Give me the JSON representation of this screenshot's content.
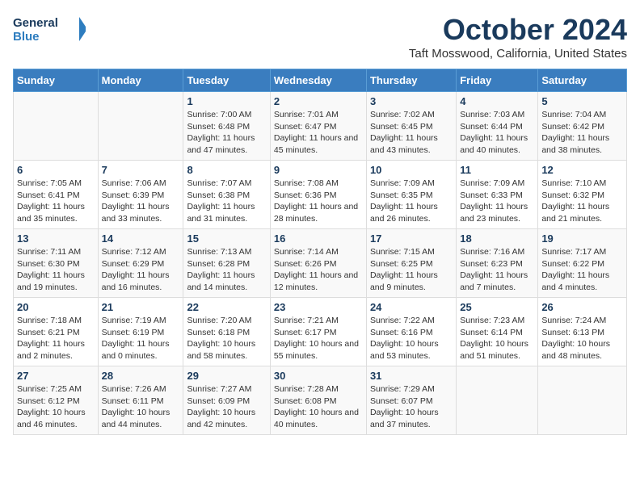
{
  "header": {
    "logo_line1": "General",
    "logo_line2": "Blue",
    "month": "October 2024",
    "location": "Taft Mosswood, California, United States"
  },
  "weekdays": [
    "Sunday",
    "Monday",
    "Tuesday",
    "Wednesday",
    "Thursday",
    "Friday",
    "Saturday"
  ],
  "weeks": [
    [
      null,
      null,
      {
        "day": "1",
        "sunrise": "Sunrise: 7:00 AM",
        "sunset": "Sunset: 6:48 PM",
        "daylight": "Daylight: 11 hours and 47 minutes."
      },
      {
        "day": "2",
        "sunrise": "Sunrise: 7:01 AM",
        "sunset": "Sunset: 6:47 PM",
        "daylight": "Daylight: 11 hours and 45 minutes."
      },
      {
        "day": "3",
        "sunrise": "Sunrise: 7:02 AM",
        "sunset": "Sunset: 6:45 PM",
        "daylight": "Daylight: 11 hours and 43 minutes."
      },
      {
        "day": "4",
        "sunrise": "Sunrise: 7:03 AM",
        "sunset": "Sunset: 6:44 PM",
        "daylight": "Daylight: 11 hours and 40 minutes."
      },
      {
        "day": "5",
        "sunrise": "Sunrise: 7:04 AM",
        "sunset": "Sunset: 6:42 PM",
        "daylight": "Daylight: 11 hours and 38 minutes."
      }
    ],
    [
      {
        "day": "6",
        "sunrise": "Sunrise: 7:05 AM",
        "sunset": "Sunset: 6:41 PM",
        "daylight": "Daylight: 11 hours and 35 minutes."
      },
      {
        "day": "7",
        "sunrise": "Sunrise: 7:06 AM",
        "sunset": "Sunset: 6:39 PM",
        "daylight": "Daylight: 11 hours and 33 minutes."
      },
      {
        "day": "8",
        "sunrise": "Sunrise: 7:07 AM",
        "sunset": "Sunset: 6:38 PM",
        "daylight": "Daylight: 11 hours and 31 minutes."
      },
      {
        "day": "9",
        "sunrise": "Sunrise: 7:08 AM",
        "sunset": "Sunset: 6:36 PM",
        "daylight": "Daylight: 11 hours and 28 minutes."
      },
      {
        "day": "10",
        "sunrise": "Sunrise: 7:09 AM",
        "sunset": "Sunset: 6:35 PM",
        "daylight": "Daylight: 11 hours and 26 minutes."
      },
      {
        "day": "11",
        "sunrise": "Sunrise: 7:09 AM",
        "sunset": "Sunset: 6:33 PM",
        "daylight": "Daylight: 11 hours and 23 minutes."
      },
      {
        "day": "12",
        "sunrise": "Sunrise: 7:10 AM",
        "sunset": "Sunset: 6:32 PM",
        "daylight": "Daylight: 11 hours and 21 minutes."
      }
    ],
    [
      {
        "day": "13",
        "sunrise": "Sunrise: 7:11 AM",
        "sunset": "Sunset: 6:30 PM",
        "daylight": "Daylight: 11 hours and 19 minutes."
      },
      {
        "day": "14",
        "sunrise": "Sunrise: 7:12 AM",
        "sunset": "Sunset: 6:29 PM",
        "daylight": "Daylight: 11 hours and 16 minutes."
      },
      {
        "day": "15",
        "sunrise": "Sunrise: 7:13 AM",
        "sunset": "Sunset: 6:28 PM",
        "daylight": "Daylight: 11 hours and 14 minutes."
      },
      {
        "day": "16",
        "sunrise": "Sunrise: 7:14 AM",
        "sunset": "Sunset: 6:26 PM",
        "daylight": "Daylight: 11 hours and 12 minutes."
      },
      {
        "day": "17",
        "sunrise": "Sunrise: 7:15 AM",
        "sunset": "Sunset: 6:25 PM",
        "daylight": "Daylight: 11 hours and 9 minutes."
      },
      {
        "day": "18",
        "sunrise": "Sunrise: 7:16 AM",
        "sunset": "Sunset: 6:23 PM",
        "daylight": "Daylight: 11 hours and 7 minutes."
      },
      {
        "day": "19",
        "sunrise": "Sunrise: 7:17 AM",
        "sunset": "Sunset: 6:22 PM",
        "daylight": "Daylight: 11 hours and 4 minutes."
      }
    ],
    [
      {
        "day": "20",
        "sunrise": "Sunrise: 7:18 AM",
        "sunset": "Sunset: 6:21 PM",
        "daylight": "Daylight: 11 hours and 2 minutes."
      },
      {
        "day": "21",
        "sunrise": "Sunrise: 7:19 AM",
        "sunset": "Sunset: 6:19 PM",
        "daylight": "Daylight: 11 hours and 0 minutes."
      },
      {
        "day": "22",
        "sunrise": "Sunrise: 7:20 AM",
        "sunset": "Sunset: 6:18 PM",
        "daylight": "Daylight: 10 hours and 58 minutes."
      },
      {
        "day": "23",
        "sunrise": "Sunrise: 7:21 AM",
        "sunset": "Sunset: 6:17 PM",
        "daylight": "Daylight: 10 hours and 55 minutes."
      },
      {
        "day": "24",
        "sunrise": "Sunrise: 7:22 AM",
        "sunset": "Sunset: 6:16 PM",
        "daylight": "Daylight: 10 hours and 53 minutes."
      },
      {
        "day": "25",
        "sunrise": "Sunrise: 7:23 AM",
        "sunset": "Sunset: 6:14 PM",
        "daylight": "Daylight: 10 hours and 51 minutes."
      },
      {
        "day": "26",
        "sunrise": "Sunrise: 7:24 AM",
        "sunset": "Sunset: 6:13 PM",
        "daylight": "Daylight: 10 hours and 48 minutes."
      }
    ],
    [
      {
        "day": "27",
        "sunrise": "Sunrise: 7:25 AM",
        "sunset": "Sunset: 6:12 PM",
        "daylight": "Daylight: 10 hours and 46 minutes."
      },
      {
        "day": "28",
        "sunrise": "Sunrise: 7:26 AM",
        "sunset": "Sunset: 6:11 PM",
        "daylight": "Daylight: 10 hours and 44 minutes."
      },
      {
        "day": "29",
        "sunrise": "Sunrise: 7:27 AM",
        "sunset": "Sunset: 6:09 PM",
        "daylight": "Daylight: 10 hours and 42 minutes."
      },
      {
        "day": "30",
        "sunrise": "Sunrise: 7:28 AM",
        "sunset": "Sunset: 6:08 PM",
        "daylight": "Daylight: 10 hours and 40 minutes."
      },
      {
        "day": "31",
        "sunrise": "Sunrise: 7:29 AM",
        "sunset": "Sunset: 6:07 PM",
        "daylight": "Daylight: 10 hours and 37 minutes."
      },
      null,
      null
    ]
  ]
}
